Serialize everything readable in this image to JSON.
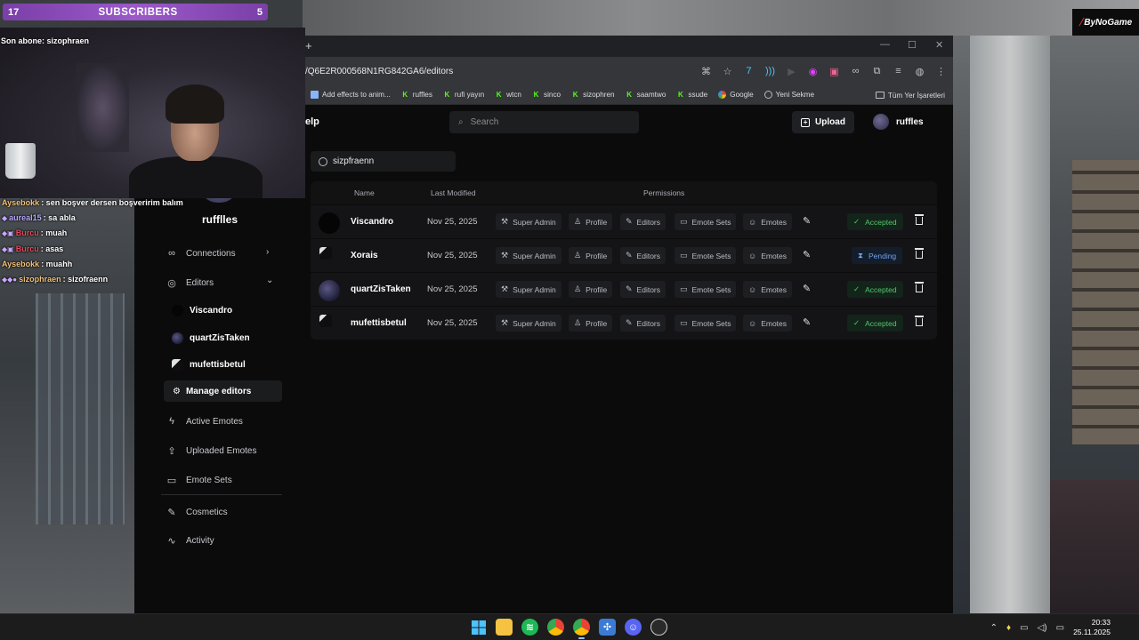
{
  "overlay": {
    "sub_count_left": "17",
    "sub_label": "SUBSCRIBERS",
    "sub_count_right": "5",
    "last_sub": "Son abone: sizophraen",
    "brand": "ByNoGame",
    "brand_mark": "⧸"
  },
  "chat": [
    {
      "user": "Aysebokk",
      "msg": " : sen boşver dersen boşveririm balım",
      "color": "#f1c27b",
      "badge": ""
    },
    {
      "user": "aureal15",
      "msg": " : sa abla",
      "color": "#b9a8ff",
      "badge": "◆"
    },
    {
      "user": "Burcu",
      "msg": " : muah",
      "color": "#e84a5f",
      "badge": "◆▣"
    },
    {
      "user": "Burcu",
      "msg": " : asas",
      "color": "#e84a5f",
      "badge": "◆▣"
    },
    {
      "user": "Aysebokk",
      "msg": " : muahh",
      "color": "#f1c27b",
      "badge": ""
    },
    {
      "user": "sizophraen",
      "msg": " : sizofraenn",
      "color": "#f1c27b",
      "badge": "◆◆●"
    }
  ],
  "browser": {
    "new_tab": "+",
    "url": "/Q6E2R000568N1RG842GA6/editors",
    "controls": {
      "minimize": "—",
      "maximize": "☐",
      "close": "✕"
    },
    "bookmarks": [
      {
        "label": "Add effects to anim...",
        "icon": "doc"
      },
      {
        "label": "ruffles",
        "icon": "k"
      },
      {
        "label": "rufi yayın",
        "icon": "k"
      },
      {
        "label": "wtcn",
        "icon": "k"
      },
      {
        "label": "sinco",
        "icon": "k"
      },
      {
        "label": "sizophren",
        "icon": "k"
      },
      {
        "label": "saamtwo",
        "icon": "k"
      },
      {
        "label": "ssude",
        "icon": "k"
      },
      {
        "label": "Google",
        "icon": "g"
      },
      {
        "label": "Yeni Sekme",
        "icon": "web"
      }
    ],
    "bookmarks_all": "Tüm Yer İşaretleri"
  },
  "page": {
    "help": "elp",
    "search_placeholder": "Search",
    "upload_label": "Upload",
    "profile_name": "ruffles",
    "user_chip": "sizpfraenn",
    "table_headers": {
      "name": "Name",
      "modified": "Last Modified",
      "permissions": "Permissions"
    },
    "perm_labels": {
      "super_admin": "Super Admin",
      "profile": "Profile",
      "editors": "Editors",
      "emote_sets": "Emote Sets",
      "emotes": "Emotes"
    },
    "editors": [
      {
        "name": "Viscandro",
        "date": "Nov 25, 2025",
        "status": "Accepted",
        "status_type": "accepted",
        "avatar": "dark"
      },
      {
        "name": "Xorais",
        "date": "Nov 25, 2025",
        "status": "Pending",
        "status_type": "pending",
        "avatar": "glitch"
      },
      {
        "name": "quartZisTaken",
        "date": "Nov 25, 2025",
        "status": "Accepted",
        "status_type": "accepted",
        "avatar": "galaxy"
      },
      {
        "name": "mufettisbetul",
        "date": "Nov 25, 2025",
        "status": "Accepted",
        "status_type": "accepted",
        "avatar": "glitch"
      }
    ]
  },
  "sidebar": {
    "name": "rufflles",
    "connections": "Connections",
    "editors": "Editors",
    "sub_editors": [
      "Viscandro",
      "quartZisTaken",
      "mufettisbetul"
    ],
    "manage_editors": "Manage editors",
    "active_emotes": "Active Emotes",
    "uploaded_emotes": "Uploaded Emotes",
    "emote_sets": "Emote Sets",
    "cosmetics": "Cosmetics",
    "activity": "Activity"
  },
  "taskbar": {
    "time": "20:33",
    "date": "25.11.2025",
    "apps": [
      "windows-start",
      "file-explorer",
      "spotify",
      "chrome",
      "chrome-active",
      "app-grid",
      "discord",
      "steam"
    ]
  }
}
